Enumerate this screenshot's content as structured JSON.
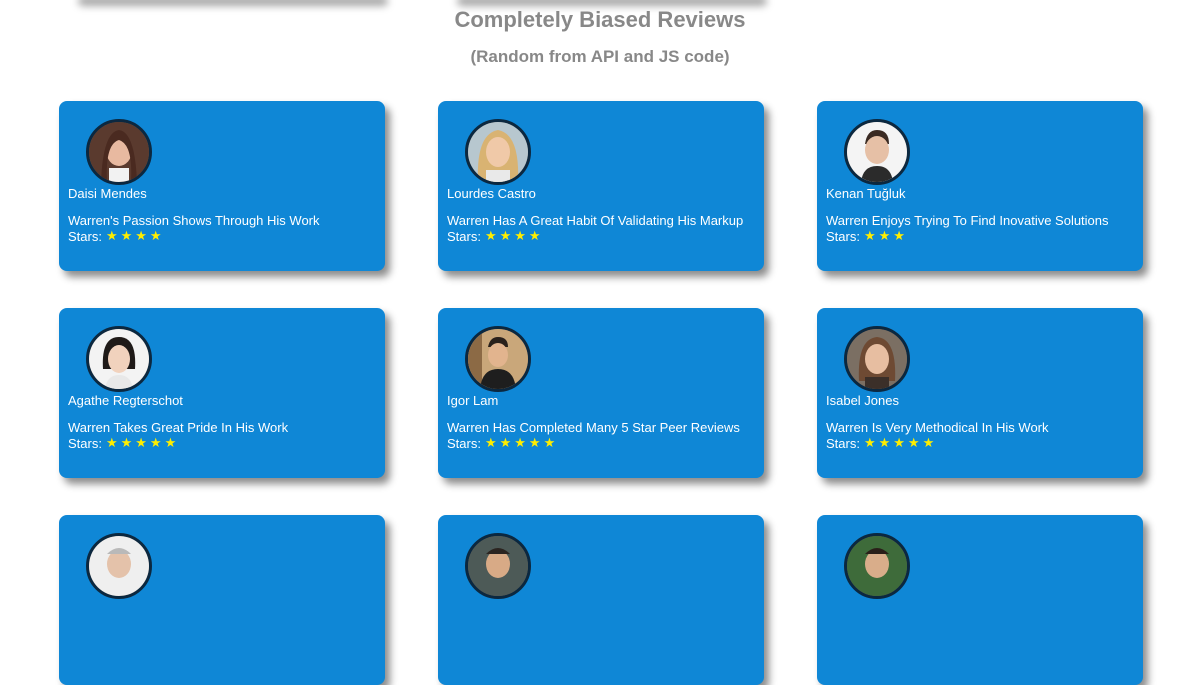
{
  "page": {
    "title": "Completely Biased Reviews",
    "subtitle": "(Random from API and JS code)"
  },
  "colors": {
    "card_bg": "#0f87d6",
    "heading": "#888888",
    "star": "#ffee00"
  },
  "reviews": [
    {
      "name": "Daisi Mendes",
      "text": "Warren's Passion Shows Through His Work",
      "stars_label": "Stars:",
      "rating": 4,
      "stars": "★★★★"
    },
    {
      "name": "Lourdes Castro",
      "text": "Warren Has A Great Habit Of Validating His Markup",
      "stars_label": "Stars:",
      "rating": 4,
      "stars": "★★★★"
    },
    {
      "name": "Kenan Tuğluk",
      "text": "Warren Enjoys Trying To Find Inovative Solutions",
      "stars_label": "Stars:",
      "rating": 3,
      "stars": "★★★"
    },
    {
      "name": "Agathe Regterschot",
      "text": "Warren Takes Great Pride In His Work",
      "stars_label": "Stars:",
      "rating": 5,
      "stars": "★★★★★"
    },
    {
      "name": "Igor Lam",
      "text": "Warren Has Completed Many 5 Star Peer Reviews",
      "stars_label": "Stars:",
      "rating": 5,
      "stars": "★★★★★"
    },
    {
      "name": "Isabel Jones",
      "text": "Warren Is Very Methodical In His Work",
      "stars_label": "Stars:",
      "rating": 5,
      "stars": "★★★★★"
    }
  ]
}
